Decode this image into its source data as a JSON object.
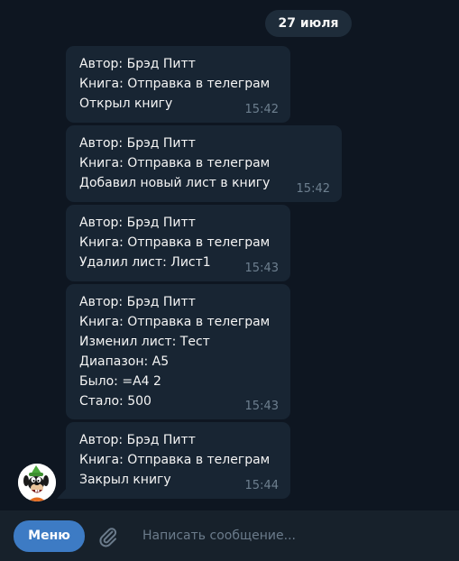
{
  "chat": {
    "date_label": "27 июля",
    "messages": [
      {
        "lines": [
          "Автор: Брэд Питт",
          "Книга: Отправка в телеграм",
          "Открыл книгу"
        ],
        "time": "15:42"
      },
      {
        "lines": [
          "Автор: Брэд Питт",
          "Книга: Отправка в телеграм",
          "Добавил новый лист в книгу"
        ],
        "time": "15:42"
      },
      {
        "lines": [
          "Автор: Брэд Питт",
          "Книга: Отправка в телеграм",
          "Удалил лист: Лист1"
        ],
        "time": "15:43"
      },
      {
        "lines": [
          "Автор: Брэд Питт",
          "Книга: Отправка в телеграм",
          "Изменил лист: Тест",
          "Диапазон: A5",
          "Было: =A4 2",
          "Стало: 500"
        ],
        "time": "15:43"
      },
      {
        "lines": [
          "Автор: Брэд Питт",
          "Книга: Отправка в телеграм",
          "Закрыл книгу"
        ],
        "time": "15:44"
      }
    ],
    "avatar_icon": "goofy-avatar-icon"
  },
  "composer": {
    "menu_label": "Меню",
    "attach_icon": "paperclip-icon",
    "placeholder": "Написать сообщение..."
  },
  "colors": {
    "background": "#0e1621",
    "bubble": "#182533",
    "input_bar": "#17212b",
    "menu_button": "#3d7bc4",
    "time_text": "#6d7f8f"
  }
}
